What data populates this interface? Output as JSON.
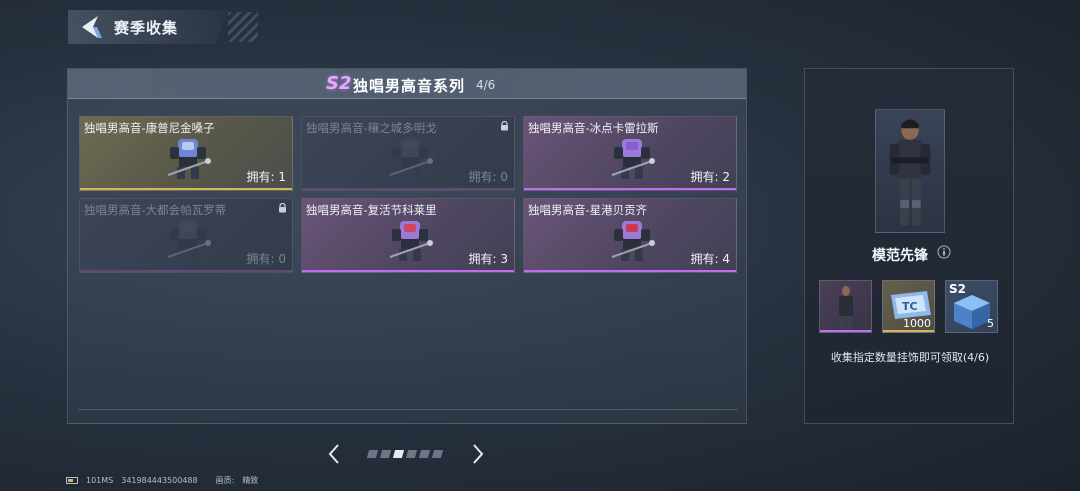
{
  "header": {
    "title": "赛季收集"
  },
  "series": {
    "badge": "S2",
    "title": "独唱男高音系列",
    "progress": "4/6"
  },
  "cards": [
    {
      "name": "独唱男高音-康普尼金嗓子",
      "owned": "拥有: 1",
      "rarity": "gold",
      "locked": false
    },
    {
      "name": "独唱男高音-穰之城多明戈",
      "owned": "拥有: 0",
      "rarity": "locked",
      "locked": true
    },
    {
      "name": "独唱男高音-冰点卡雷拉斯",
      "owned": "拥有: 2",
      "rarity": "purple",
      "locked": false
    },
    {
      "name": "独唱男高音-大都会帕瓦罗蒂",
      "owned": "拥有: 0",
      "rarity": "locked",
      "locked": true
    },
    {
      "name": "独唱男高音-复活节科莱里",
      "owned": "拥有: 3",
      "rarity": "purple",
      "locked": false
    },
    {
      "name": "独唱男高音-星港贝贡齐",
      "owned": "拥有: 4",
      "rarity": "purple",
      "locked": false
    }
  ],
  "pager": {
    "pages": 6,
    "current": 3
  },
  "reward": {
    "name": "模范先锋",
    "items": [
      {
        "type": "character-skin",
        "qty": ""
      },
      {
        "type": "currency-ticket",
        "qty": "1000"
      },
      {
        "type": "s2-crate",
        "tag": "S2",
        "qty": "5"
      }
    ],
    "description": "收集指定数量挂饰即可领取(4/6)"
  },
  "footer": {
    "ping": "101MS",
    "id": "341984443500488",
    "quality_label": "画质:",
    "quality_value": "精致"
  },
  "colors": {
    "gold": "#d7b35a",
    "purple": "#c26cf0",
    "accent_pink": "#e8a8ff"
  }
}
